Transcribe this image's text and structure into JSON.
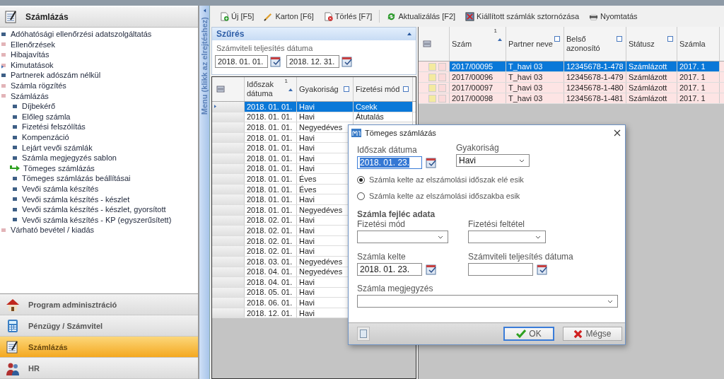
{
  "sidebar": {
    "title": "Számlázás",
    "items": [
      {
        "label": "Adóhatósági ellenőrzési adatszolgáltatás",
        "kind": "leaf",
        "selected": false
      },
      {
        "label": "Ellenőrzések",
        "kind": "folder",
        "selected": false
      },
      {
        "label": "Hibajavítás",
        "kind": "folder",
        "selected": false
      },
      {
        "label": "Kimutatások",
        "kind": "folder",
        "selected": false
      },
      {
        "label": "Partnerek adószám nélkül",
        "kind": "leaf",
        "selected": false
      },
      {
        "label": "Számla rögzítés",
        "kind": "folder",
        "selected": false
      },
      {
        "label": "Számlázás",
        "kind": "folder",
        "selected": false,
        "children": [
          {
            "label": "Díjbekérő",
            "kind": "leaf",
            "selected": false
          },
          {
            "label": "Előleg számla",
            "kind": "leaf",
            "selected": false
          },
          {
            "label": "Fizetési felszólítás",
            "kind": "leaf",
            "selected": false
          },
          {
            "label": "Kompenzáció",
            "kind": "leaf",
            "selected": false
          },
          {
            "label": "Lejárt vevői számlák",
            "kind": "leaf",
            "selected": false
          },
          {
            "label": "Számla megjegyzés sablon",
            "kind": "leaf",
            "selected": false
          },
          {
            "label": "Tömeges számlázás",
            "selected": true
          },
          {
            "label": "Tömeges számlázás beállításai",
            "kind": "leaf",
            "selected": false
          },
          {
            "label": "Vevői számla készítés",
            "kind": "leaf",
            "selected": false
          },
          {
            "label": "Vevői számla készítés - készlet",
            "kind": "leaf",
            "selected": false
          },
          {
            "label": "Vevői számla készítés - készlet, gyorsított",
            "kind": "leaf",
            "selected": false
          },
          {
            "label": "Vevői számla készítés - KP (egyszerűsített)",
            "kind": "leaf",
            "selected": false
          }
        ]
      },
      {
        "label": "Várható bevétel / kiadás",
        "kind": "folder",
        "selected": false
      }
    ]
  },
  "modules": [
    {
      "label": "Program adminisztráció",
      "kind": "house",
      "selected": false
    },
    {
      "label": "Pénzügy / Számvitel",
      "kind": "calculator",
      "selected": false
    },
    {
      "label": "Számlázás",
      "kind": "notepad",
      "selected": true
    },
    {
      "label": "HR",
      "kind": "people",
      "selected": false
    }
  ],
  "menu_toggle": "Menu (klikk az elrejtéshez)",
  "toolbar": [
    {
      "label": "Új [F5]",
      "kind": "new"
    },
    {
      "label": "Karton [F6]",
      "kind": "edit"
    },
    {
      "label": "Törlés [F7]",
      "kind": "delete"
    },
    {
      "label": "Aktualizálás [F2]",
      "kind": "refresh"
    },
    {
      "label": "Kiállított számlák sztornózása",
      "kind": "storno"
    },
    {
      "label": "Nyomtatás",
      "kind": "print"
    }
  ],
  "filter": {
    "title": "Szűrés",
    "label": "Számviteli teljesítés dátuma",
    "from": "2018. 01. 01.",
    "to": "2018. 12. 31."
  },
  "period_table": {
    "columns": [
      {
        "label": "Időszak dátuma",
        "kind": "sorted",
        "sort_order": "1"
      },
      {
        "label": "Gyakoriság",
        "kind": "filter"
      },
      {
        "label": "Fizetési mód",
        "kind": "filter"
      }
    ],
    "rows": [
      {
        "cells": [
          "2018. 01. 01.",
          "Havi",
          "Csekk"
        ],
        "selected": true
      },
      {
        "cells": [
          "2018. 01. 01.",
          "Havi",
          "Átutalás"
        ],
        "selected": false
      },
      {
        "cells": [
          "2018. 01. 01.",
          "Negyedéves"
        ],
        "selected": false
      },
      {
        "cells": [
          "2018. 01. 01.",
          "Havi"
        ],
        "selected": false
      },
      {
        "cells": [
          "2018. 01. 01.",
          "Havi"
        ],
        "selected": false
      },
      {
        "cells": [
          "2018. 01. 01.",
          "Havi"
        ],
        "selected": false
      },
      {
        "cells": [
          "2018. 01. 01.",
          "Havi"
        ],
        "selected": false
      },
      {
        "cells": [
          "2018. 01. 01.",
          "Éves"
        ],
        "selected": false
      },
      {
        "cells": [
          "2018. 01. 01.",
          "Éves"
        ],
        "selected": false
      },
      {
        "cells": [
          "2018. 01. 01.",
          "Havi"
        ],
        "selected": false
      },
      {
        "cells": [
          "2018. 01. 01.",
          "Negyedéves"
        ],
        "selected": false
      },
      {
        "cells": [
          "2018. 02. 01.",
          "Havi"
        ],
        "selected": false
      },
      {
        "cells": [
          "2018. 02. 01.",
          "Havi"
        ],
        "selected": false
      },
      {
        "cells": [
          "2018. 02. 01.",
          "Havi"
        ],
        "selected": false
      },
      {
        "cells": [
          "2018. 02. 01.",
          "Havi"
        ],
        "selected": false
      },
      {
        "cells": [
          "2018. 03. 01.",
          "Negyedéves"
        ],
        "selected": false
      },
      {
        "cells": [
          "2018. 04. 01.",
          "Negyedéves"
        ],
        "selected": false
      },
      {
        "cells": [
          "2018. 04. 01.",
          "Havi"
        ],
        "selected": false
      },
      {
        "cells": [
          "2018. 05. 01.",
          "Havi"
        ],
        "selected": false
      },
      {
        "cells": [
          "2018. 06. 01.",
          "Havi"
        ],
        "selected": false
      },
      {
        "cells": [
          "2018. 12. 01.",
          "Havi"
        ],
        "selected": false
      }
    ]
  },
  "invoice_table": {
    "columns": [
      {
        "label": "Szám",
        "kind": "sorted",
        "sort_order": "1"
      },
      {
        "label": "Partner neve",
        "kind": "filter"
      },
      {
        "label": "Belső azonosító",
        "kind": "filter"
      },
      {
        "label": "Státusz",
        "kind": "filter"
      },
      {
        "label": "Számla",
        "kind": "plain"
      }
    ],
    "rows": [
      {
        "cells": [
          "2017/00095",
          "T_havi 03",
          "12345678-1-478",
          "Számlázott",
          "2017. 1"
        ],
        "selected": true
      },
      {
        "cells": [
          "2017/00096",
          "T_havi 03",
          "12345678-1-479",
          "Számlázott",
          "2017. 1"
        ],
        "selected": false
      },
      {
        "cells": [
          "2017/00097",
          "T_havi 03",
          "12345678-1-480",
          "Számlázott",
          "2017. 1"
        ],
        "selected": false
      },
      {
        "cells": [
          "2017/00098",
          "T_havi 03",
          "12345678-1-481",
          "Számlázott",
          "2017. 1"
        ],
        "selected": false
      }
    ]
  },
  "dialog": {
    "title": "Tömeges számlázás",
    "period_label": "Időszak dátuma",
    "period_value": "2018. 01. 23.",
    "frequency_label": "Gyakoriság",
    "frequency_value": "Havi",
    "options": [
      {
        "label": "Számla kelte az elszámolási időszak elé esik",
        "selected": true
      },
      {
        "label": "Számla kelte az elszámolási időszakba esik",
        "selected": false
      }
    ],
    "section": "Számla fejléc adata",
    "payment_method_label": "Fizetési mód",
    "payment_terms_label": "Fizetési feltétel",
    "invoice_date_label": "Számla kelte",
    "invoice_date_value": "2018. 01. 23.",
    "accounting_date_label": "Számviteli teljesítés dátuma",
    "note_label": "Számla megjegyzés",
    "buttons": [
      {
        "label": "OK",
        "kind": "ok"
      },
      {
        "label": "Mégse",
        "kind": "cancel"
      }
    ]
  }
}
